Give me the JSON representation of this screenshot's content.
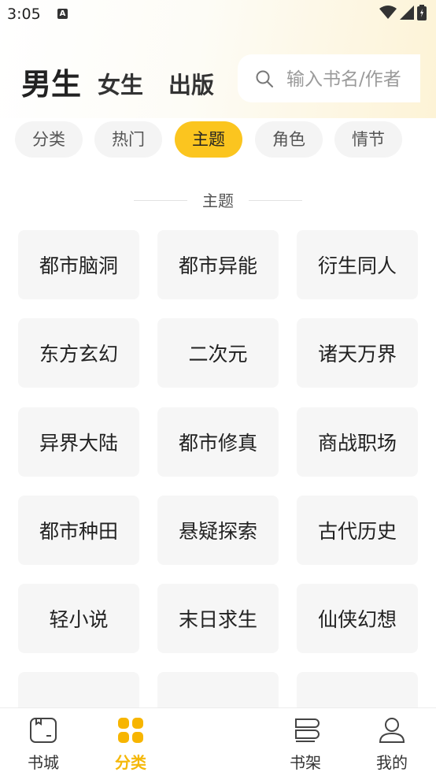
{
  "status_bar": {
    "time": "3:05",
    "notification_glyph": "A"
  },
  "header": {
    "tabs": [
      {
        "label": "男生",
        "active": true
      },
      {
        "label": "女生",
        "active": false
      },
      {
        "label": "出版",
        "active": false
      }
    ],
    "search": {
      "placeholder": "输入书名/作者",
      "icon": "search-icon"
    }
  },
  "filters": [
    {
      "label": "分类",
      "active": false
    },
    {
      "label": "热门",
      "active": false
    },
    {
      "label": "主题",
      "active": true
    },
    {
      "label": "角色",
      "active": false
    },
    {
      "label": "情节",
      "active": false
    }
  ],
  "section": {
    "title": "主题"
  },
  "categories": [
    "都市脑洞",
    "都市异能",
    "衍生同人",
    "东方玄幻",
    "二次元",
    "诸天万界",
    "异界大陆",
    "都市修真",
    "商战职场",
    "都市种田",
    "悬疑探索",
    "古代历史",
    "轻小说",
    "末日求生",
    "仙侠幻想"
  ],
  "bottom_nav": [
    {
      "label": "书城",
      "icon": "bookstore-icon",
      "active": false
    },
    {
      "label": "分类",
      "icon": "category-grid-icon",
      "active": true
    },
    {
      "label": "书架",
      "icon": "bookshelf-icon",
      "active": false
    },
    {
      "label": "我的",
      "icon": "profile-icon",
      "active": false
    }
  ],
  "colors": {
    "accent": "#fbc51f",
    "accent_text": "#f5b80a",
    "chip_bg": "#f4f4f4",
    "cell_bg": "#f6f6f6"
  }
}
